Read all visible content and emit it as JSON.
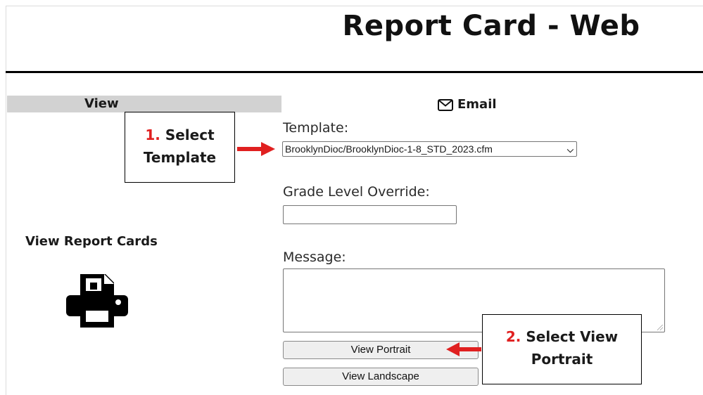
{
  "page": {
    "title": "Report Card - Web"
  },
  "left_panel": {
    "header": "View",
    "view_report_cards_label": "View Report Cards",
    "printer_icon": "printer-icon"
  },
  "form": {
    "email_header": "Email",
    "email_icon": "envelope-icon",
    "template_label": "Template:",
    "template_selected": "BrooklynDioc/BrooklynDioc-1-8_STD_2023.cfm",
    "grade_level_label": "Grade Level Override:",
    "grade_level_value": "",
    "message_label": "Message:",
    "message_value": "",
    "view_portrait_button": "View Portrait",
    "view_landscape_button": "View Landscape"
  },
  "callouts": {
    "step1_num": "1.",
    "step1_text_a": "Select",
    "step1_text_b": "Template",
    "step2_num": "2.",
    "step2_text_a": "Select View",
    "step2_text_b": "Portrait",
    "arrow_color": "#e02020"
  }
}
